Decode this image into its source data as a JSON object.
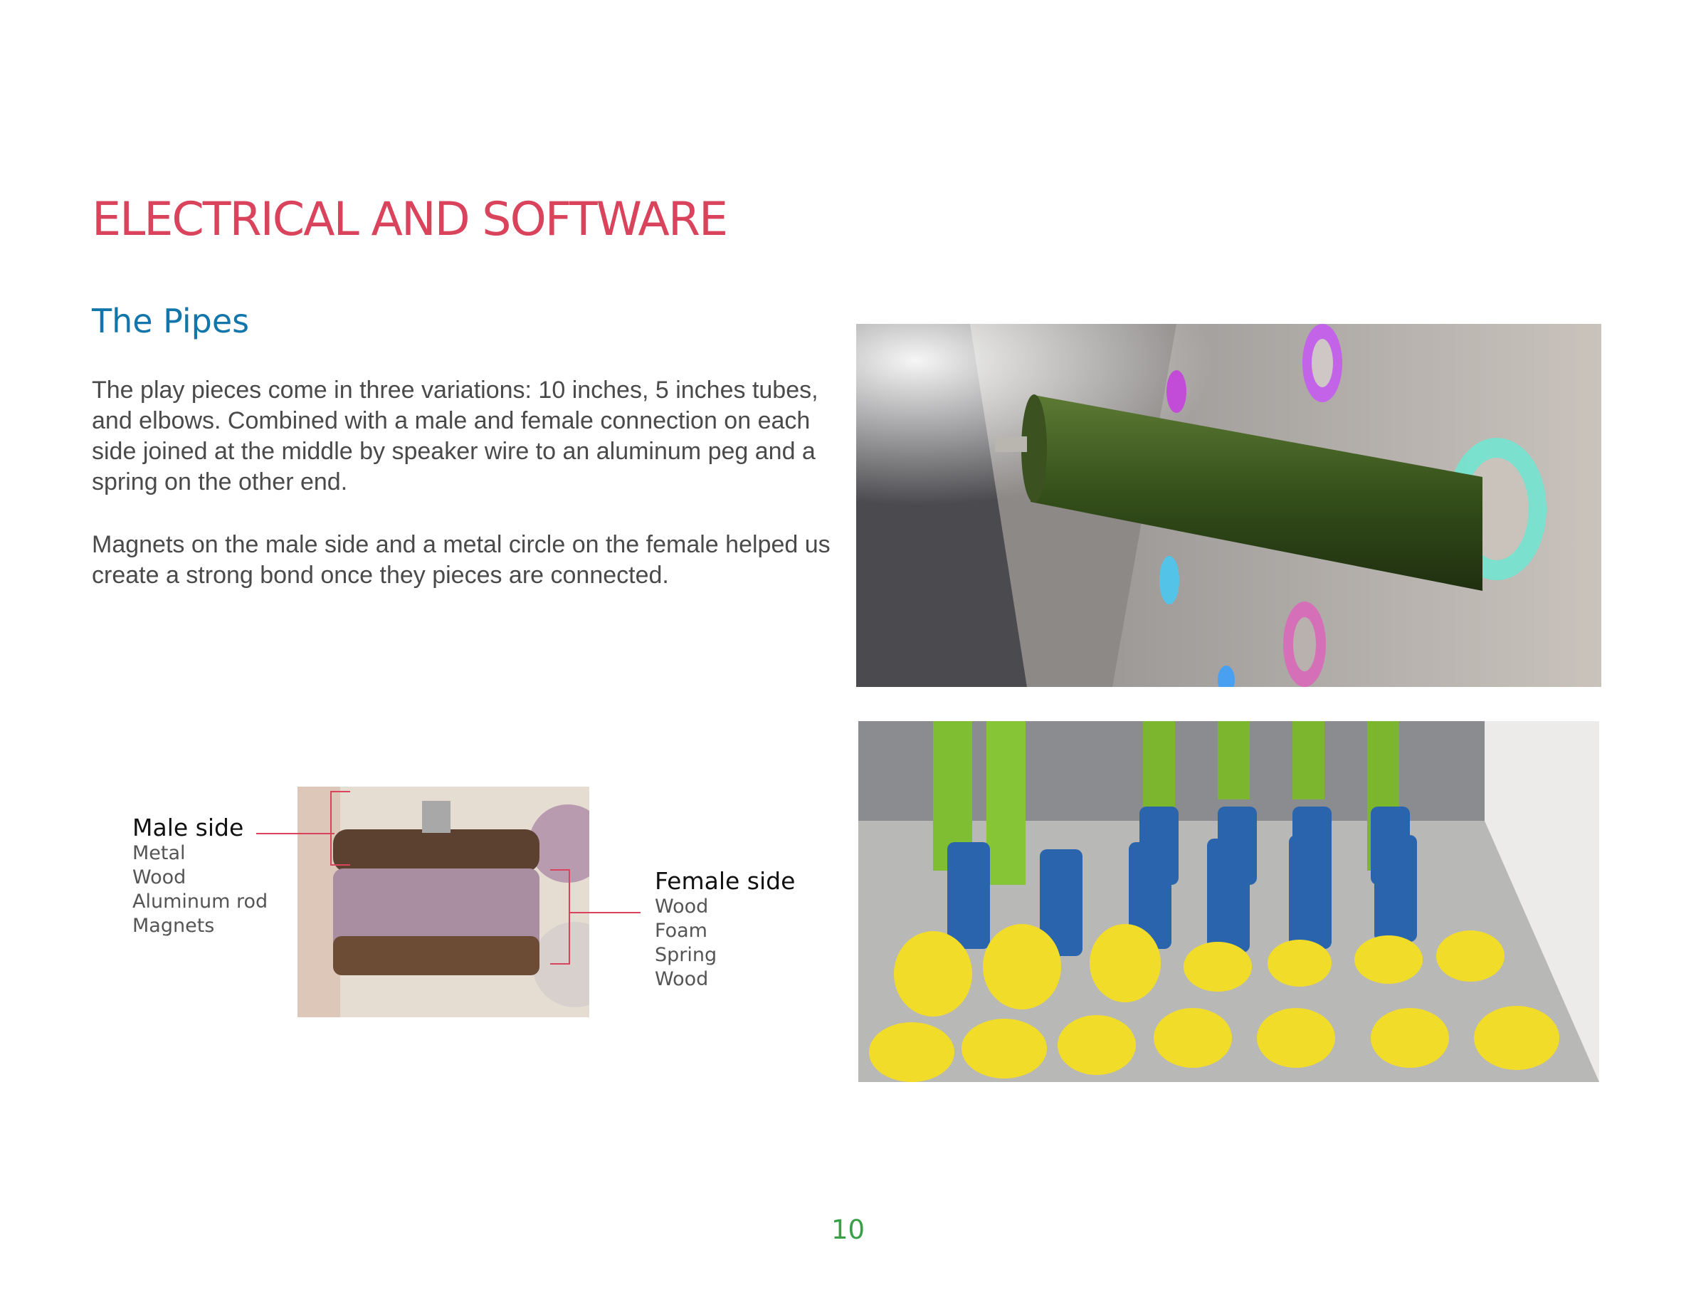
{
  "page": {
    "title": "ELECTRICAL AND SOFTWARE",
    "section_title": "The Pipes",
    "paragraphs": [
      "The play pieces come in three variations: 10 inches, 5 inches tubes, and elbows. Combined with a male and female connection on each side joined at the middle by speaker wire to an aluminum peg and a spring on the other end.",
      "Magnets on the male side and a metal circle on the female helped us create a strong bond once they pieces are connected."
    ],
    "page_number": "10"
  },
  "diagram": {
    "male": {
      "heading": "Male side",
      "items": [
        "Metal",
        "Wood",
        "Aluminum rod",
        "Magnets"
      ]
    },
    "female": {
      "heading": "Female side",
      "items": [
        "Wood",
        "Foam",
        "Spring",
        "Wood"
      ]
    }
  },
  "colors": {
    "title": "#d9445c",
    "section_title": "#1276ab",
    "body_text": "#4a4a4a",
    "page_number": "#3aa048",
    "leader_lines": "#d9445c"
  }
}
